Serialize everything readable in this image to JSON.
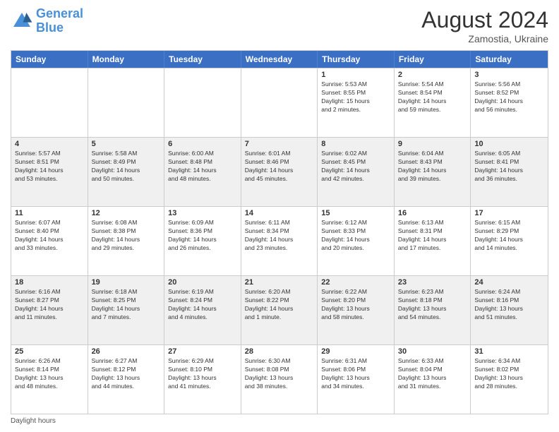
{
  "header": {
    "logo_line1": "General",
    "logo_line2": "Blue",
    "main_title": "August 2024",
    "subtitle": "Zamostia, Ukraine"
  },
  "days_of_week": [
    "Sunday",
    "Monday",
    "Tuesday",
    "Wednesday",
    "Thursday",
    "Friday",
    "Saturday"
  ],
  "footer": {
    "note": "Daylight hours"
  },
  "weeks": [
    [
      {
        "day": "",
        "info": "",
        "empty": true
      },
      {
        "day": "",
        "info": "",
        "empty": true
      },
      {
        "day": "",
        "info": "",
        "empty": true
      },
      {
        "day": "",
        "info": "",
        "empty": true
      },
      {
        "day": "1",
        "info": "Sunrise: 5:53 AM\nSunset: 8:55 PM\nDaylight: 15 hours\nand 2 minutes.",
        "empty": false
      },
      {
        "day": "2",
        "info": "Sunrise: 5:54 AM\nSunset: 8:54 PM\nDaylight: 14 hours\nand 59 minutes.",
        "empty": false
      },
      {
        "day": "3",
        "info": "Sunrise: 5:56 AM\nSunset: 8:52 PM\nDaylight: 14 hours\nand 56 minutes.",
        "empty": false
      }
    ],
    [
      {
        "day": "4",
        "info": "Sunrise: 5:57 AM\nSunset: 8:51 PM\nDaylight: 14 hours\nand 53 minutes.",
        "empty": false
      },
      {
        "day": "5",
        "info": "Sunrise: 5:58 AM\nSunset: 8:49 PM\nDaylight: 14 hours\nand 50 minutes.",
        "empty": false
      },
      {
        "day": "6",
        "info": "Sunrise: 6:00 AM\nSunset: 8:48 PM\nDaylight: 14 hours\nand 48 minutes.",
        "empty": false
      },
      {
        "day": "7",
        "info": "Sunrise: 6:01 AM\nSunset: 8:46 PM\nDaylight: 14 hours\nand 45 minutes.",
        "empty": false
      },
      {
        "day": "8",
        "info": "Sunrise: 6:02 AM\nSunset: 8:45 PM\nDaylight: 14 hours\nand 42 minutes.",
        "empty": false
      },
      {
        "day": "9",
        "info": "Sunrise: 6:04 AM\nSunset: 8:43 PM\nDaylight: 14 hours\nand 39 minutes.",
        "empty": false
      },
      {
        "day": "10",
        "info": "Sunrise: 6:05 AM\nSunset: 8:41 PM\nDaylight: 14 hours\nand 36 minutes.",
        "empty": false
      }
    ],
    [
      {
        "day": "11",
        "info": "Sunrise: 6:07 AM\nSunset: 8:40 PM\nDaylight: 14 hours\nand 33 minutes.",
        "empty": false
      },
      {
        "day": "12",
        "info": "Sunrise: 6:08 AM\nSunset: 8:38 PM\nDaylight: 14 hours\nand 29 minutes.",
        "empty": false
      },
      {
        "day": "13",
        "info": "Sunrise: 6:09 AM\nSunset: 8:36 PM\nDaylight: 14 hours\nand 26 minutes.",
        "empty": false
      },
      {
        "day": "14",
        "info": "Sunrise: 6:11 AM\nSunset: 8:34 PM\nDaylight: 14 hours\nand 23 minutes.",
        "empty": false
      },
      {
        "day": "15",
        "info": "Sunrise: 6:12 AM\nSunset: 8:33 PM\nDaylight: 14 hours\nand 20 minutes.",
        "empty": false
      },
      {
        "day": "16",
        "info": "Sunrise: 6:13 AM\nSunset: 8:31 PM\nDaylight: 14 hours\nand 17 minutes.",
        "empty": false
      },
      {
        "day": "17",
        "info": "Sunrise: 6:15 AM\nSunset: 8:29 PM\nDaylight: 14 hours\nand 14 minutes.",
        "empty": false
      }
    ],
    [
      {
        "day": "18",
        "info": "Sunrise: 6:16 AM\nSunset: 8:27 PM\nDaylight: 14 hours\nand 11 minutes.",
        "empty": false
      },
      {
        "day": "19",
        "info": "Sunrise: 6:18 AM\nSunset: 8:25 PM\nDaylight: 14 hours\nand 7 minutes.",
        "empty": false
      },
      {
        "day": "20",
        "info": "Sunrise: 6:19 AM\nSunset: 8:24 PM\nDaylight: 14 hours\nand 4 minutes.",
        "empty": false
      },
      {
        "day": "21",
        "info": "Sunrise: 6:20 AM\nSunset: 8:22 PM\nDaylight: 14 hours\nand 1 minute.",
        "empty": false
      },
      {
        "day": "22",
        "info": "Sunrise: 6:22 AM\nSunset: 8:20 PM\nDaylight: 13 hours\nand 58 minutes.",
        "empty": false
      },
      {
        "day": "23",
        "info": "Sunrise: 6:23 AM\nSunset: 8:18 PM\nDaylight: 13 hours\nand 54 minutes.",
        "empty": false
      },
      {
        "day": "24",
        "info": "Sunrise: 6:24 AM\nSunset: 8:16 PM\nDaylight: 13 hours\nand 51 minutes.",
        "empty": false
      }
    ],
    [
      {
        "day": "25",
        "info": "Sunrise: 6:26 AM\nSunset: 8:14 PM\nDaylight: 13 hours\nand 48 minutes.",
        "empty": false
      },
      {
        "day": "26",
        "info": "Sunrise: 6:27 AM\nSunset: 8:12 PM\nDaylight: 13 hours\nand 44 minutes.",
        "empty": false
      },
      {
        "day": "27",
        "info": "Sunrise: 6:29 AM\nSunset: 8:10 PM\nDaylight: 13 hours\nand 41 minutes.",
        "empty": false
      },
      {
        "day": "28",
        "info": "Sunrise: 6:30 AM\nSunset: 8:08 PM\nDaylight: 13 hours\nand 38 minutes.",
        "empty": false
      },
      {
        "day": "29",
        "info": "Sunrise: 6:31 AM\nSunset: 8:06 PM\nDaylight: 13 hours\nand 34 minutes.",
        "empty": false
      },
      {
        "day": "30",
        "info": "Sunrise: 6:33 AM\nSunset: 8:04 PM\nDaylight: 13 hours\nand 31 minutes.",
        "empty": false
      },
      {
        "day": "31",
        "info": "Sunrise: 6:34 AM\nSunset: 8:02 PM\nDaylight: 13 hours\nand 28 minutes.",
        "empty": false
      }
    ]
  ]
}
